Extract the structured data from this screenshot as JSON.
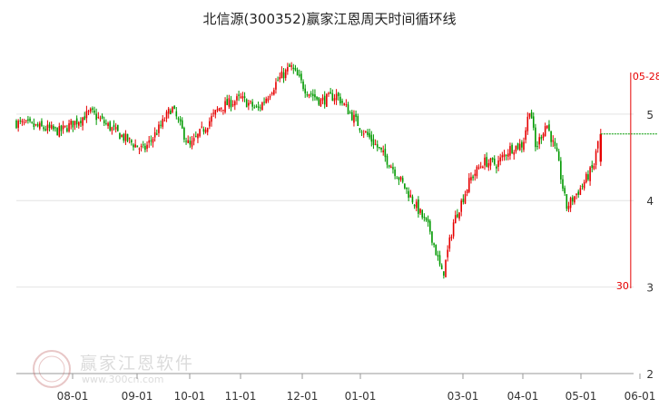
{
  "chart_data": {
    "type": "candlestick",
    "title": "北信源(300352)赢家江恩周天时间循环线",
    "xlabel": "",
    "ylabel": "",
    "x_ticks": [
      "08-01",
      "09-01",
      "10-01",
      "11-01",
      "12-01",
      "01-01",
      "03-01",
      "04-01",
      "05-01",
      "06-01"
    ],
    "y_ticks": [
      "5",
      "4",
      "3",
      "2"
    ],
    "ylim": [
      2,
      5.9
    ],
    "up_color": "#e60000",
    "down_color": "#009900",
    "last_close": 4.77,
    "cycle_marker": {
      "date_label": "05-28",
      "value_label": "30",
      "color": "#e60000"
    },
    "series": [
      {
        "name": "",
        "segments": [
          {
            "from": "07-15",
            "close": 4.9
          },
          {
            "from": "07-29",
            "close": 4.8
          },
          {
            "from": "08-10",
            "close": 5.02
          },
          {
            "from": "08-25",
            "close": 4.75
          },
          {
            "from": "09-05",
            "close": 4.58
          },
          {
            "from": "09-15",
            "close": 4.85
          },
          {
            "from": "09-22",
            "close": 5.08
          },
          {
            "from": "10-01",
            "close": 4.62
          },
          {
            "from": "10-20",
            "close": 5.08
          },
          {
            "from": "11-01",
            "close": 5.18
          },
          {
            "from": "11-10",
            "close": 5.05
          },
          {
            "from": "11-20",
            "close": 5.38
          },
          {
            "from": "11-27",
            "close": 5.55
          },
          {
            "from": "12-03",
            "close": 5.28
          },
          {
            "from": "12-11",
            "close": 5.15
          },
          {
            "from": "12-20",
            "close": 5.22
          },
          {
            "from": "01-01",
            "close": 4.85
          },
          {
            "from": "01-10",
            "close": 4.65
          },
          {
            "from": "01-20",
            "close": 4.4
          },
          {
            "from": "02-01",
            "close": 4.0
          },
          {
            "from": "02-12",
            "close": 3.65
          },
          {
            "from": "02-20",
            "close": 3.12
          },
          {
            "from": "02-27",
            "close": 3.75
          },
          {
            "from": "03-05",
            "close": 4.25
          },
          {
            "from": "03-12",
            "close": 4.45
          },
          {
            "from": "03-19",
            "close": 4.42
          },
          {
            "from": "03-26",
            "close": 4.6
          },
          {
            "from": "04-01",
            "close": 4.65
          },
          {
            "from": "04-05",
            "close": 5.1
          },
          {
            "from": "04-08",
            "close": 4.6
          },
          {
            "from": "04-14",
            "close": 4.9
          },
          {
            "from": "04-20",
            "close": 4.5
          },
          {
            "from": "04-25",
            "close": 3.92
          },
          {
            "from": "05-01",
            "close": 4.15
          },
          {
            "from": "05-08",
            "close": 4.4
          },
          {
            "from": "05-11",
            "close": 4.78
          }
        ]
      }
    ]
  },
  "watermark": {
    "name": "赢家江恩软件",
    "url": "www.300cn.com",
    "logo_text": "赢家"
  }
}
